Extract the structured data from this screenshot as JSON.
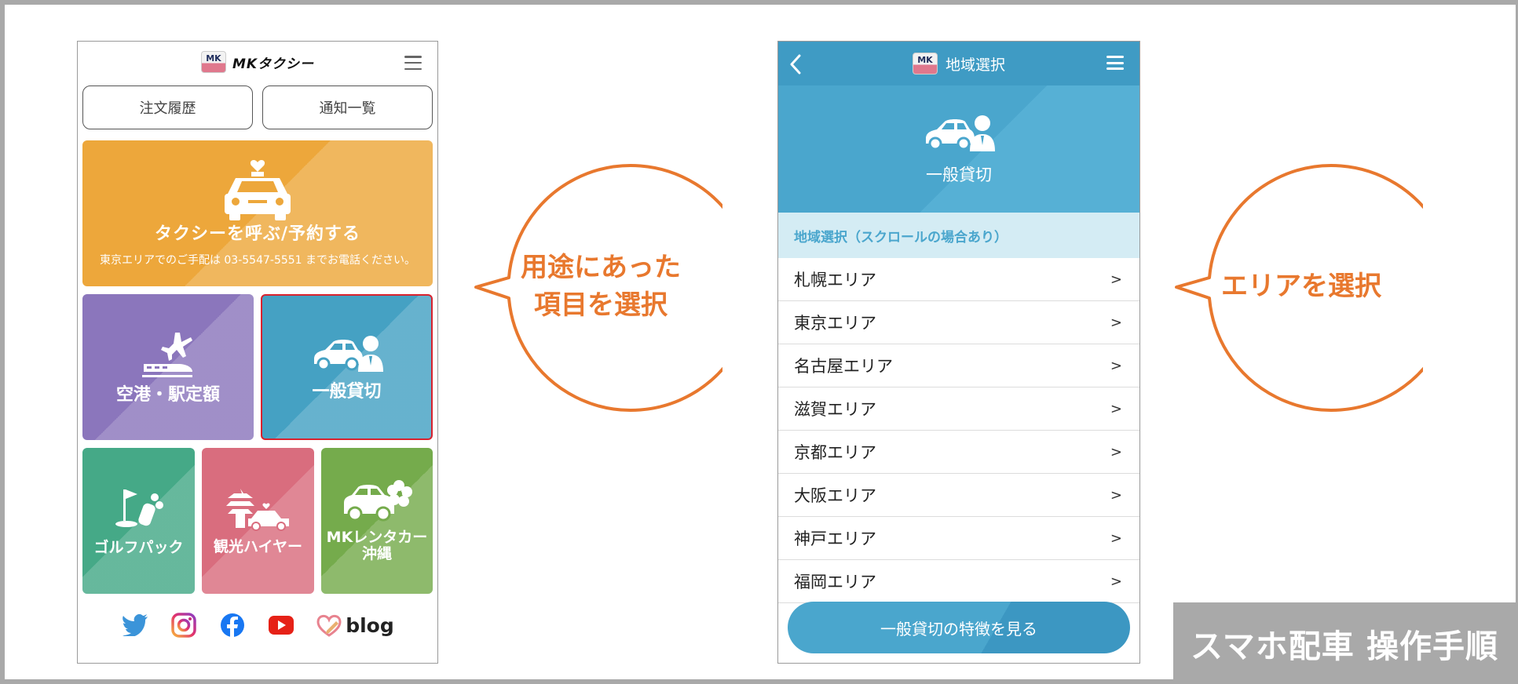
{
  "phone1": {
    "logo_text": "MKタクシー",
    "logo_mark": "MK",
    "tabs": [
      {
        "label": "注文履歴"
      },
      {
        "label": "通知一覧"
      }
    ],
    "taxi_tile": {
      "title": "タクシーを呼ぶ/予約する",
      "subtitle": "東京エリアでのご手配は 03-5547-5551 までお電話ください。"
    },
    "tiles": [
      {
        "label": "空港・駅定額",
        "color": "#8b76bc"
      },
      {
        "label": "一般貸切",
        "color": "#45a1c3",
        "selected": true
      },
      {
        "label": "ゴルフパック",
        "color": "#45a987"
      },
      {
        "label": "観光ハイヤー",
        "color": "#d96d7e"
      },
      {
        "label_line1": "MKレンタカー",
        "label_line2": "沖縄",
        "color": "#75ab4c"
      }
    ],
    "social": {
      "icons": [
        "twitter-icon",
        "instagram-icon",
        "facebook-icon",
        "youtube-icon",
        "blog-heart-icon"
      ],
      "blog_label": "blog"
    }
  },
  "bubble1": {
    "line1": "用途にあった",
    "line2": "項目を選択"
  },
  "phone2": {
    "header_title": "地域選択",
    "hero_label": "一般貸切",
    "section_label": "地域選択（スクロールの場合あり）",
    "areas": [
      {
        "label": "札幌エリア"
      },
      {
        "label": "東京エリア"
      },
      {
        "label": "名古屋エリア"
      },
      {
        "label": "滋賀エリア"
      },
      {
        "label": "京都エリア"
      },
      {
        "label": "大阪エリア"
      },
      {
        "label": "神戸エリア"
      },
      {
        "label": "福岡エリア"
      }
    ],
    "chevron": ">",
    "feature_button": "一般貸切の特徴を見る"
  },
  "bubble2": {
    "text": "エリアを選択"
  },
  "caption": "スマホ配車 操作手順",
  "colors": {
    "accent_orange": "#e8782e",
    "blue": "#4aa6cd",
    "selected_border": "#d8222e",
    "taxi_tile": "#eda73b",
    "caption_bg": "#a9a9a9"
  }
}
